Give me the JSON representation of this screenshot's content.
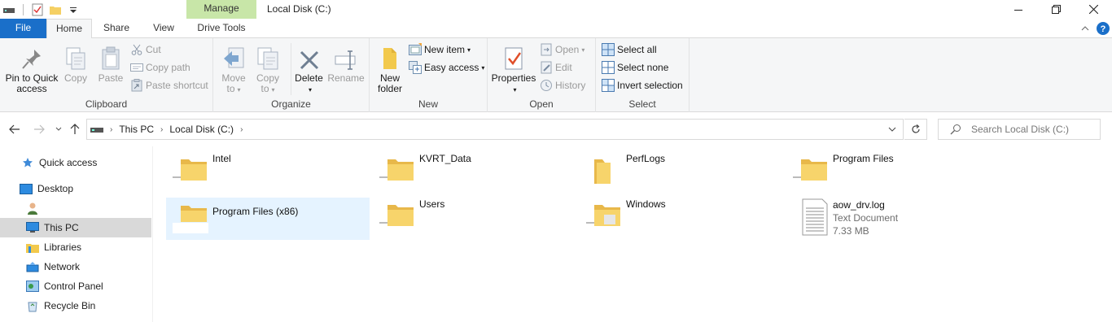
{
  "window": {
    "title": "Local Disk (C:)",
    "contextual_tab": "Manage"
  },
  "tabs": {
    "file": "File",
    "home": "Home",
    "share": "Share",
    "view": "View",
    "drive_tools": "Drive Tools"
  },
  "ribbon": {
    "clipboard": {
      "label": "Clipboard",
      "pin_line1": "Pin to Quick",
      "pin_line2": "access",
      "copy": "Copy",
      "paste": "Paste",
      "cut": "Cut",
      "copy_path": "Copy path",
      "paste_shortcut": "Paste shortcut"
    },
    "organize": {
      "label": "Organize",
      "move_line1": "Move",
      "move_line2": "to",
      "copy_line1": "Copy",
      "copy_line2": "to",
      "delete": "Delete",
      "rename": "Rename"
    },
    "new": {
      "label": "New",
      "new_folder_line1": "New",
      "new_folder_line2": "folder",
      "new_item": "New item",
      "easy_access": "Easy access"
    },
    "open": {
      "label": "Open",
      "properties": "Properties",
      "open": "Open",
      "edit": "Edit",
      "history": "History"
    },
    "select": {
      "label": "Select",
      "select_all": "Select all",
      "select_none": "Select none",
      "invert": "Invert selection"
    }
  },
  "address": {
    "crumbs": [
      "This PC",
      "Local Disk (C:)"
    ],
    "search_placeholder": "Search Local Disk (C:)"
  },
  "nav": {
    "quick_access": "Quick access",
    "desktop": "Desktop",
    "this_pc": "This PC",
    "libraries": "Libraries",
    "network": "Network",
    "control_panel": "Control Panel",
    "recycle_bin": "Recycle Bin"
  },
  "items": [
    {
      "name": "Intel"
    },
    {
      "name": "KVRT_Data"
    },
    {
      "name": "PerfLogs"
    },
    {
      "name": "Program Files"
    },
    {
      "name": "Program Files (x86)"
    },
    {
      "name": "Users"
    },
    {
      "name": "Windows"
    },
    {
      "name": "aow_drv.log",
      "type": "Text Document",
      "size": "7.33 MB"
    }
  ],
  "colors": {
    "accent": "#1a6fc9",
    "manage_tab": "#c8e6a8",
    "folder": "#f2c94c",
    "selection": "#e5f3ff",
    "ribbon_bg": "#f5f6f7"
  }
}
